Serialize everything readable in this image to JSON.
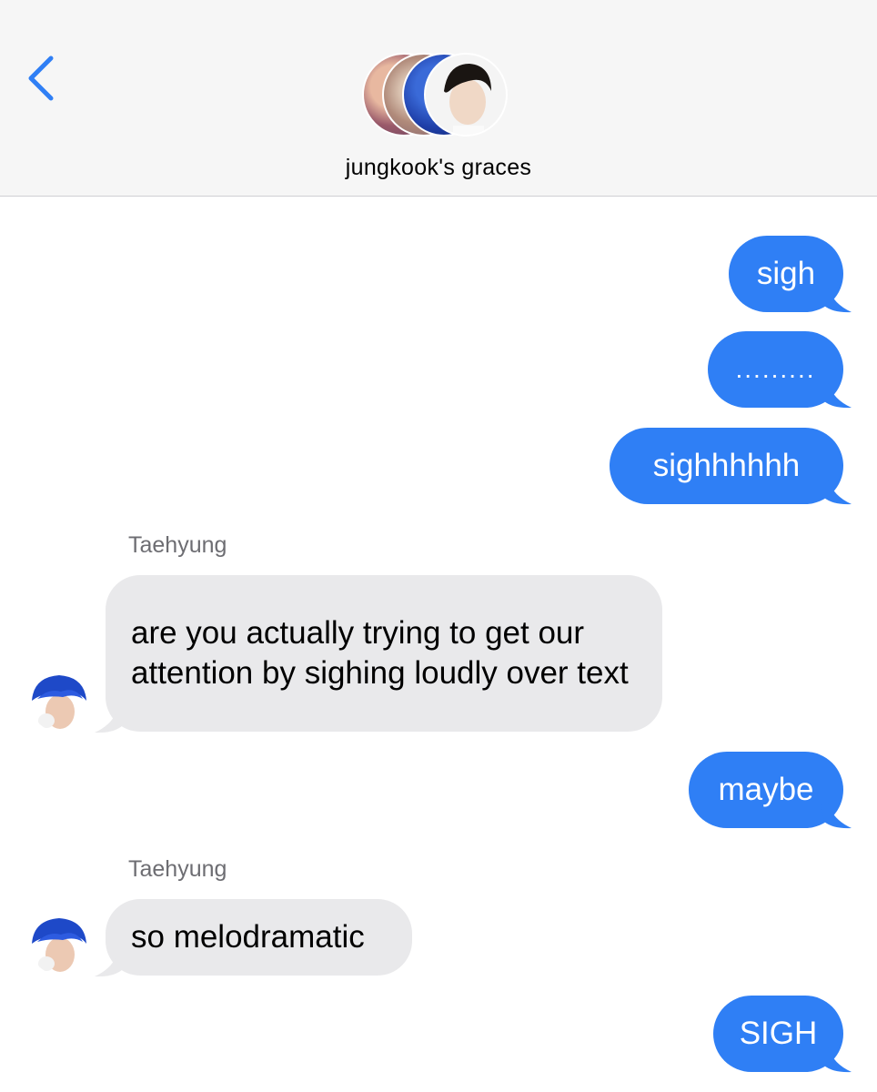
{
  "header": {
    "back_icon": "chevron-left-icon",
    "group_name": "jungkook's graces"
  },
  "colors": {
    "accent": "#2f7ff5",
    "incoming_bubble": "#e9e9eb",
    "header_bg": "#f6f6f6",
    "sender_label": "#6d6d72"
  },
  "messages": [
    {
      "direction": "outgoing",
      "text": "sigh"
    },
    {
      "direction": "outgoing",
      "text": "........."
    },
    {
      "direction": "outgoing",
      "text": "sighhhhhh"
    },
    {
      "direction": "incoming",
      "sender": "Taehyung",
      "text": "are you actually trying to get our attention by sighing loudly over text"
    },
    {
      "direction": "outgoing",
      "text": "maybe"
    },
    {
      "direction": "incoming",
      "sender": "Taehyung",
      "text": "so melodramatic"
    },
    {
      "direction": "outgoing",
      "text": "SIGH"
    }
  ]
}
